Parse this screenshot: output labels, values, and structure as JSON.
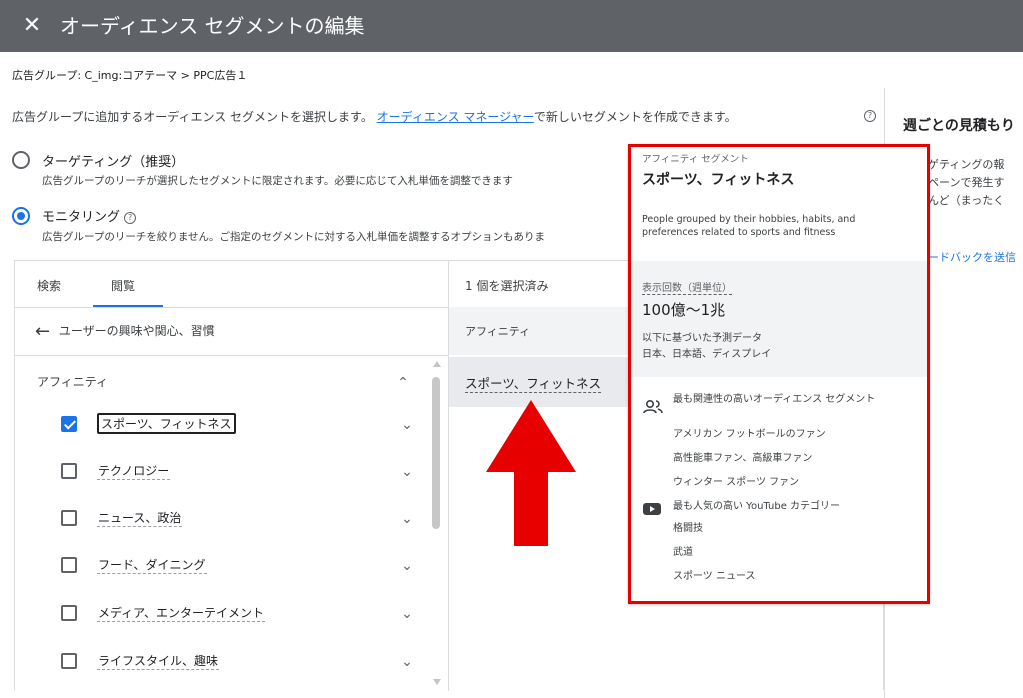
{
  "header": {
    "close_glyph": "✕",
    "title": "オーディエンス セグメントの編集"
  },
  "breadcrumb": "広告グループ: C_img:コアテーマ > PPC広告１",
  "description": {
    "before_link": "広告グループに追加するオーディエンス セグメントを選択します。",
    "link": "オーディエンス マネージャー",
    "after_link": "で新しいセグメントを作成できます。",
    "help_glyph": "?"
  },
  "options": {
    "targeting": {
      "label": "ターゲティング（推奨）",
      "desc": "広告グループのリーチが選択したセグメントに限定されます。必要に応じて入札単価を調整できます",
      "selected": false
    },
    "monitoring": {
      "label": "モニタリング",
      "desc": "広告グループのリーチを絞りません。ご指定のセグメントに対する入札単価を調整するオプションもありま",
      "selected": true
    }
  },
  "tabs": [
    {
      "label": "検索",
      "active": false
    },
    {
      "label": "閲覧",
      "active": true
    }
  ],
  "back": {
    "glyph": "←",
    "label": "ユーザーの興味や関心、習慣"
  },
  "category": {
    "title": "アフィニティ",
    "chevron_up": "⌃"
  },
  "items": [
    {
      "label": "スポーツ、フィットネス",
      "checked": true,
      "chevron": "⌄"
    },
    {
      "label": "テクノロジー",
      "checked": false,
      "chevron": "⌄"
    },
    {
      "label": "ニュース、政治",
      "checked": false,
      "chevron": "⌄"
    },
    {
      "label": "フード、ダイニング",
      "checked": false,
      "chevron": "⌄"
    },
    {
      "label": "メディア、エンターテイメント",
      "checked": false,
      "chevron": "⌄"
    },
    {
      "label": "ライフスタイル、趣味",
      "checked": false,
      "chevron": "⌄"
    }
  ],
  "selected_panel": {
    "count": "1 個を選択済み",
    "category": "アフィニティ",
    "item": "スポーツ、フィットネス"
  },
  "side": {
    "title": "週ごとの見積もり",
    "lines": [
      "ゲティングの報",
      "ペーンで発生す",
      "んど（まったく"
    ],
    "link": "ードバックを送信"
  },
  "tooltip": {
    "type": "アフィニティ セグメント",
    "name": "スポーツ、フィットネス",
    "desc": "People grouped by their hobbies, habits, and preferences related to sports and fitness",
    "stats_label": "表示回数（週単位）",
    "stats_value": "100億〜1兆",
    "note1": "以下に基づいた予測データ",
    "note2": "日本、日本語、ディスプレイ",
    "audience_title": "最も関連性の高いオーディエンス セグメント",
    "audience_items": [
      "アメリカン フットボールのファン",
      "高性能車ファン、高級車ファン",
      "ウィンター スポーツ ファン"
    ],
    "youtube_title": "最も人気の高い YouTube カテゴリー",
    "youtube_items": [
      "格闘技",
      "武道",
      "スポーツ ニュース"
    ]
  },
  "colors": {
    "header_bg": "#5f6368",
    "accent": "#1a73e8",
    "highlight_border": "#e60000",
    "arrow": "#e60000"
  }
}
